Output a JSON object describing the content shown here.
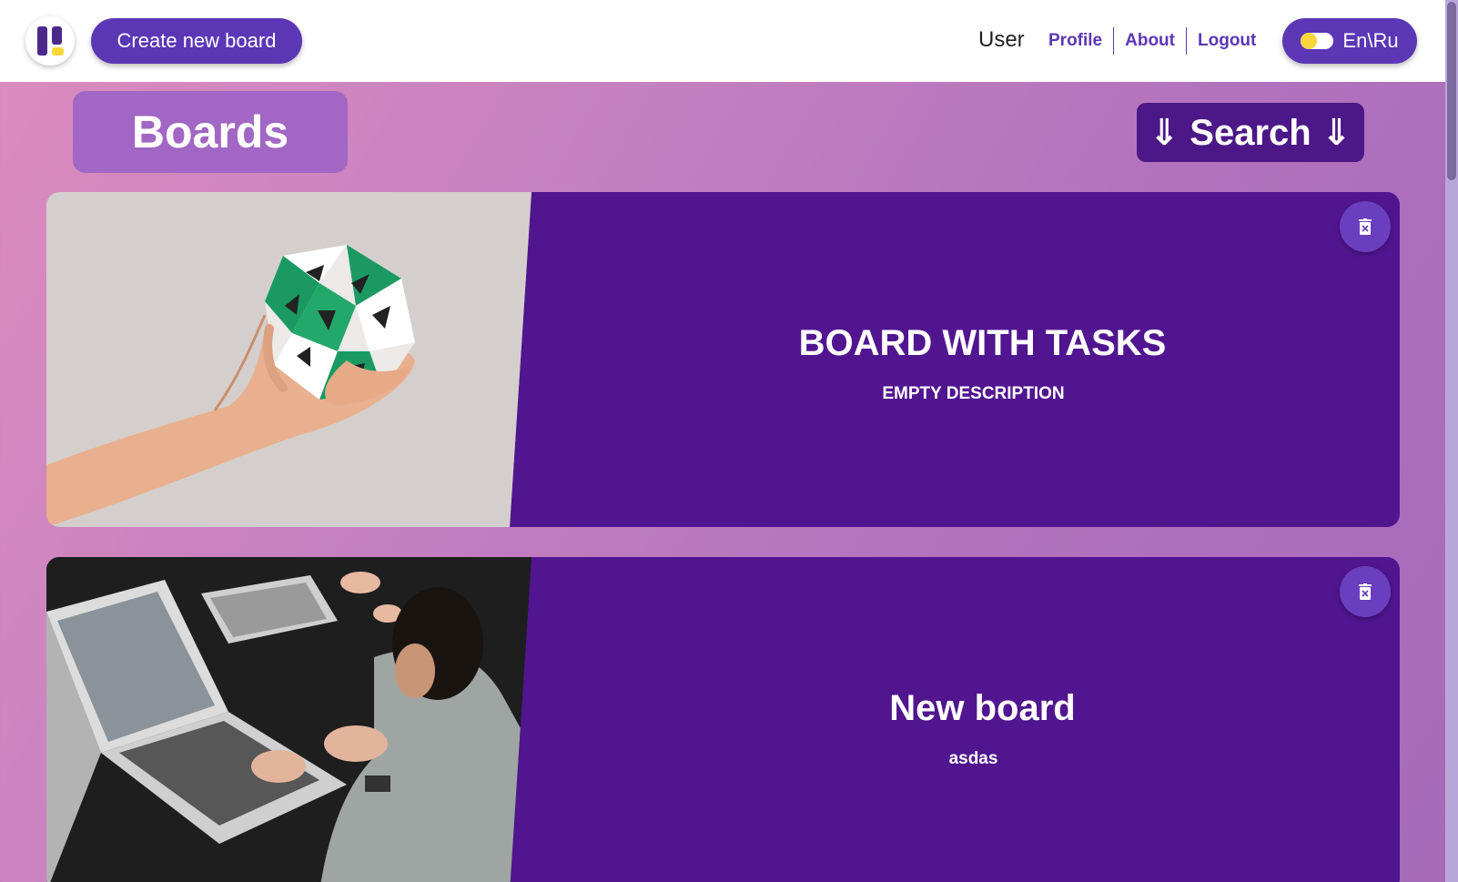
{
  "header": {
    "create_label": "Create new board",
    "user_label": "User",
    "nav": {
      "profile": "Profile",
      "about": "About",
      "logout": "Logout"
    },
    "lang_label": "En\\Ru"
  },
  "main": {
    "title": "Boards",
    "search_label": "⇓ Search ⇓",
    "boards": [
      {
        "title": "BOARD WITH TASKS",
        "description": "EMPTY DESCRIPTION"
      },
      {
        "title": "New board",
        "description": "asdas"
      }
    ]
  },
  "colors": {
    "accent": "#5b37b6",
    "card_bg": "#511590",
    "search_bg": "#4c1786",
    "title_bg": "#a266c4",
    "logo_yellow": "#f7d73c"
  }
}
